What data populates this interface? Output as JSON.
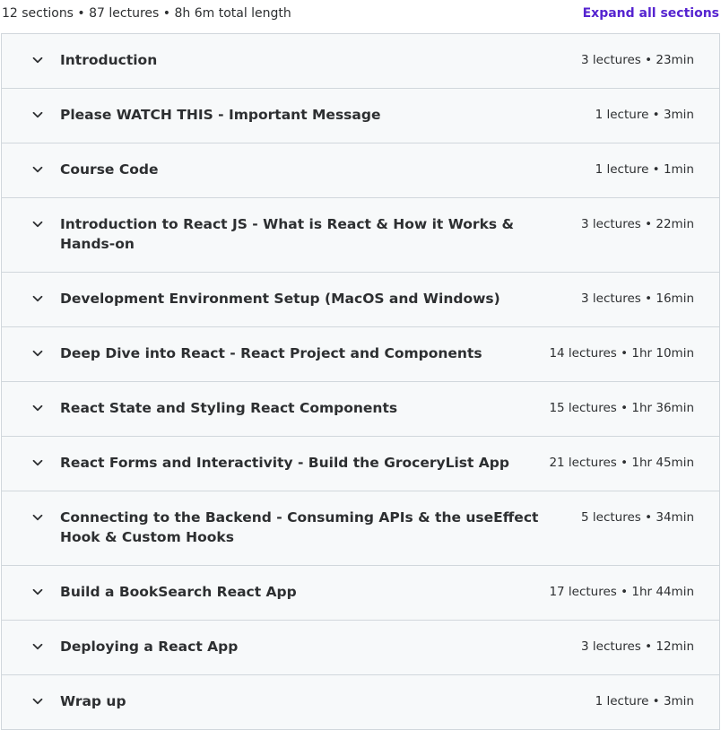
{
  "header": {
    "summary": "12 sections • 87 lectures • 8h 6m total length",
    "expand_label": "Expand all sections"
  },
  "sections": [
    {
      "title": "Introduction",
      "meta": "3 lectures • 23min"
    },
    {
      "title": "Please WATCH THIS - Important Message",
      "meta": "1 lecture • 3min"
    },
    {
      "title": "Course Code",
      "meta": "1 lecture • 1min"
    },
    {
      "title": "Introduction to React JS - What is React & How it Works & Hands-on",
      "meta": "3 lectures • 22min"
    },
    {
      "title": "Development Environment Setup (MacOS and Windows)",
      "meta": "3 lectures • 16min"
    },
    {
      "title": "Deep Dive into React - React Project and Components",
      "meta": "14 lectures • 1hr 10min"
    },
    {
      "title": "React State and Styling React Components",
      "meta": "15 lectures • 1hr 36min"
    },
    {
      "title": "React Forms and Interactivity - Build the GroceryList App",
      "meta": "21 lectures • 1hr 45min"
    },
    {
      "title": "Connecting to the Backend - Consuming APIs & the useEffect Hook & Custom Hooks",
      "meta": "5 lectures • 34min"
    },
    {
      "title": "Build a BookSearch React App",
      "meta": "17 lectures • 1hr 44min"
    },
    {
      "title": "Deploying a React App",
      "meta": "3 lectures • 12min"
    },
    {
      "title": "Wrap up",
      "meta": "1 lecture • 3min"
    }
  ],
  "icons": {
    "section_toggle": "chevron-down-icon"
  },
  "colors": {
    "accent": "#5624d0",
    "text": "#2d2f31",
    "row_background": "#f7f9fa",
    "border": "#d1d7dc"
  }
}
